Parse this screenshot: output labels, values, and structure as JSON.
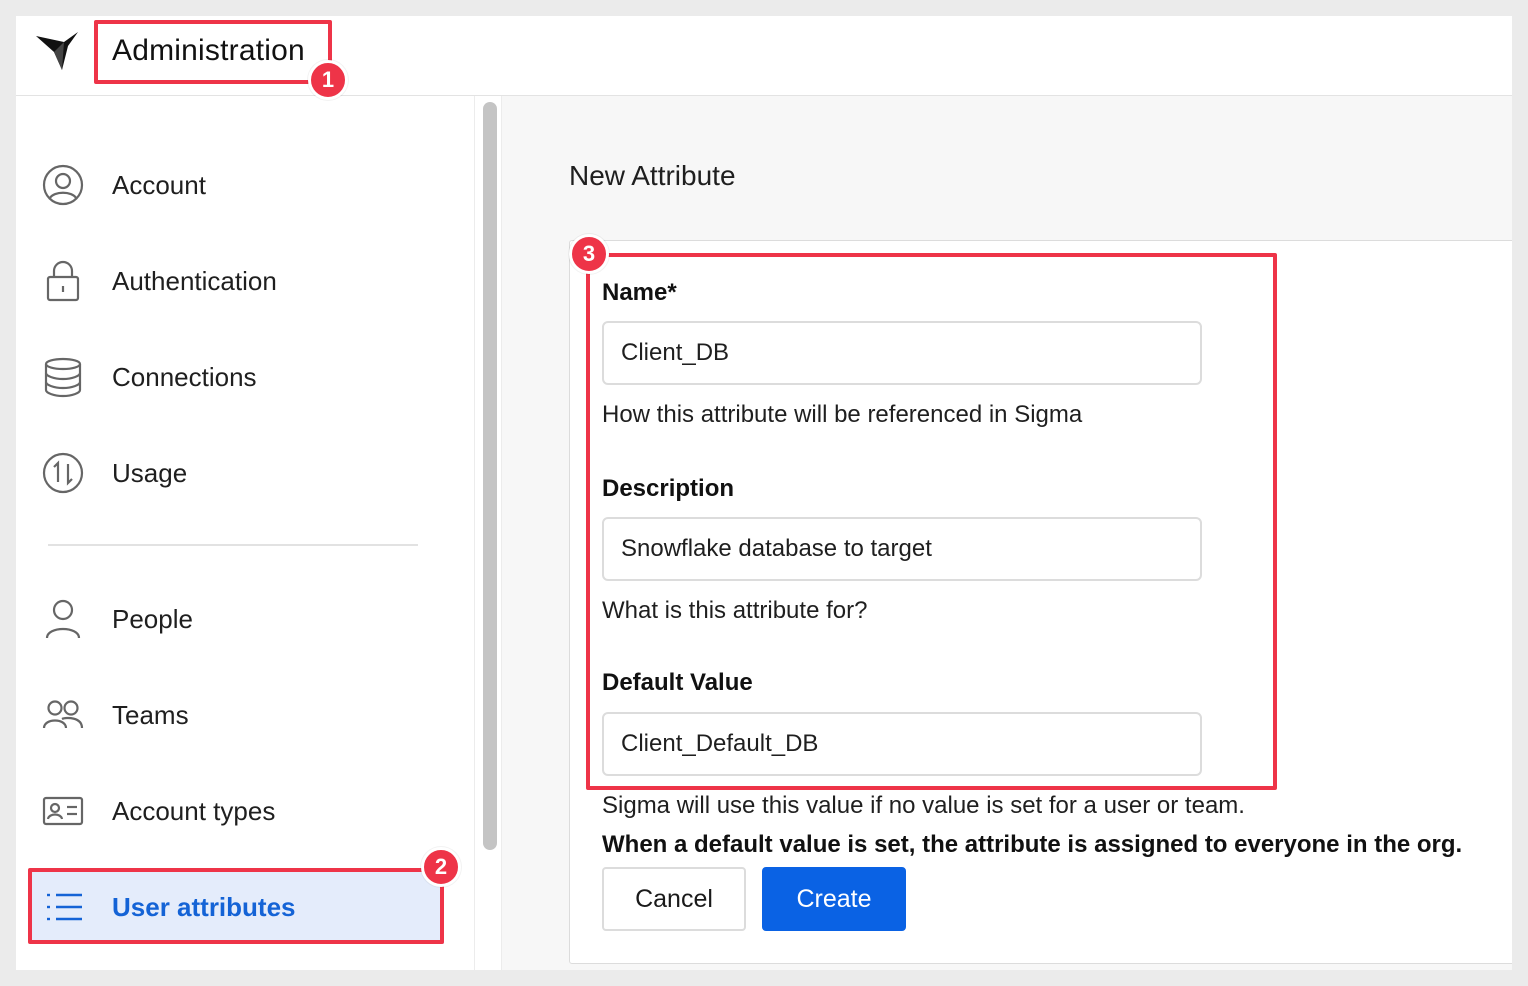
{
  "header": {
    "title": "Administration",
    "logo_icon": "sigma-bird-logo-icon"
  },
  "sidebar": {
    "items": [
      {
        "label": "Account",
        "icon": "user-circle-icon"
      },
      {
        "label": "Authentication",
        "icon": "lock-icon"
      },
      {
        "label": "Connections",
        "icon": "database-icon"
      },
      {
        "label": "Usage",
        "icon": "usage-arrows-icon"
      },
      {
        "label": "People",
        "icon": "person-icon"
      },
      {
        "label": "Teams",
        "icon": "people-icon"
      },
      {
        "label": "Account types",
        "icon": "id-card-icon"
      },
      {
        "label": "User attributes",
        "icon": "list-icon",
        "active": true
      }
    ]
  },
  "main": {
    "title": "New Attribute",
    "form": {
      "name_label": "Name*",
      "name_value": "Client_DB",
      "name_help": "How this attribute will be referenced in Sigma",
      "description_label": "Description",
      "description_value": "Snowflake database to target",
      "description_help": "What is this attribute for?",
      "default_label": "Default Value",
      "default_value": "Client_Default_DB",
      "default_help": "Sigma will use this value if no value is set for a user or team.",
      "default_help_bold": "When a default value is set, the attribute is assigned to everyone in the org.",
      "cancel_label": "Cancel",
      "create_label": "Create"
    }
  },
  "annotations": {
    "badges": [
      "1",
      "2",
      "3"
    ],
    "color": "#ee3448"
  },
  "colors": {
    "accent": "#0a62e4",
    "active_bg": "#e4ecfb",
    "active_text": "#1463d6"
  }
}
